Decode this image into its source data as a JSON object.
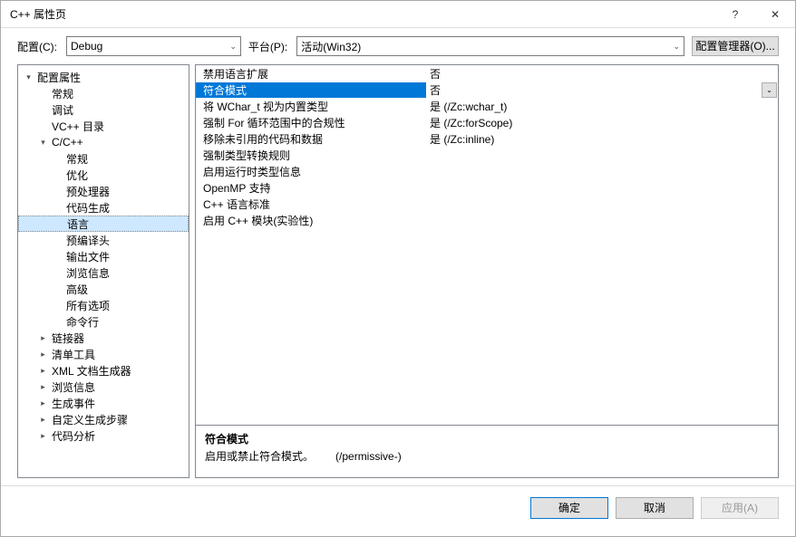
{
  "window": {
    "title": "C++ 属性页",
    "help": "?",
    "close": "✕"
  },
  "toolbar": {
    "config_label": "配置(C):",
    "config_value": "Debug",
    "platform_label": "平台(P):",
    "platform_value": "活动(Win32)",
    "cfg_mgr": "配置管理器(O)..."
  },
  "tree": [
    {
      "label": "配置属性",
      "depth": 0,
      "exp": "▾"
    },
    {
      "label": "常规",
      "depth": 1
    },
    {
      "label": "调试",
      "depth": 1
    },
    {
      "label": "VC++ 目录",
      "depth": 1
    },
    {
      "label": "C/C++",
      "depth": 1,
      "exp": "▾"
    },
    {
      "label": "常规",
      "depth": 2
    },
    {
      "label": "优化",
      "depth": 2
    },
    {
      "label": "预处理器",
      "depth": 2
    },
    {
      "label": "代码生成",
      "depth": 2
    },
    {
      "label": "语言",
      "depth": 2,
      "selected": true
    },
    {
      "label": "预编译头",
      "depth": 2
    },
    {
      "label": "输出文件",
      "depth": 2
    },
    {
      "label": "浏览信息",
      "depth": 2
    },
    {
      "label": "高级",
      "depth": 2
    },
    {
      "label": "所有选项",
      "depth": 2
    },
    {
      "label": "命令行",
      "depth": 2
    },
    {
      "label": "链接器",
      "depth": 1,
      "exp": "▸"
    },
    {
      "label": "清单工具",
      "depth": 1,
      "exp": "▸"
    },
    {
      "label": "XML 文档生成器",
      "depth": 1,
      "exp": "▸"
    },
    {
      "label": "浏览信息",
      "depth": 1,
      "exp": "▸"
    },
    {
      "label": "生成事件",
      "depth": 1,
      "exp": "▸"
    },
    {
      "label": "自定义生成步骤",
      "depth": 1,
      "exp": "▸"
    },
    {
      "label": "代码分析",
      "depth": 1,
      "exp": "▸"
    }
  ],
  "grid": [
    {
      "key": "禁用语言扩展",
      "val": "否"
    },
    {
      "key": "符合模式",
      "val": "否",
      "selected": true,
      "dropdown": true
    },
    {
      "key": "将 WChar_t 视为内置类型",
      "val": "是 (/Zc:wchar_t)"
    },
    {
      "key": "强制 For 循环范围中的合规性",
      "val": "是 (/Zc:forScope)"
    },
    {
      "key": "移除未引用的代码和数据",
      "val": "是 (/Zc:inline)"
    },
    {
      "key": "强制类型转换规则",
      "val": ""
    },
    {
      "key": "启用运行时类型信息",
      "val": ""
    },
    {
      "key": "OpenMP 支持",
      "val": ""
    },
    {
      "key": "C++ 语言标准",
      "val": ""
    },
    {
      "key": "启用 C++ 模块(实验性)",
      "val": ""
    }
  ],
  "desc": {
    "title": "符合模式",
    "text": "启用或禁止符合模式。",
    "flag": "(/permissive-)"
  },
  "footer": {
    "ok": "确定",
    "cancel": "取消",
    "apply": "应用(A)"
  }
}
